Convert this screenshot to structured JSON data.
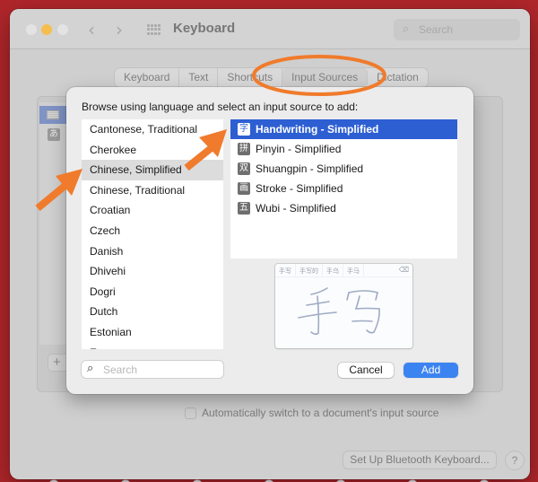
{
  "window": {
    "title": "Keyboard",
    "search_placeholder": "Search",
    "tabs": [
      {
        "label": "Keyboard",
        "active": false
      },
      {
        "label": "Text",
        "active": false
      },
      {
        "label": "Shortcuts",
        "active": false
      },
      {
        "label": "Input Sources",
        "active": true
      },
      {
        "label": "Dictation",
        "active": false
      }
    ],
    "input_sources_sidebar": [
      {
        "icon": "us-flag-icon",
        "selected": true
      },
      {
        "icon": "japanese-kana-icon",
        "glyph": "あ",
        "selected": false
      }
    ],
    "add_button": "+",
    "auto_switch_label": "Automatically switch to a document's input source",
    "auto_switch_checked": false,
    "bluetooth_button": "Set Up Bluetooth Keyboard...",
    "help_button": "?"
  },
  "sheet": {
    "title": "Browse using language and select an input source to add:",
    "languages": [
      {
        "label": "Cantonese, Traditional",
        "selected": false
      },
      {
        "label": "Cherokee",
        "selected": false
      },
      {
        "label": "Chinese, Simplified",
        "selected": true
      },
      {
        "label": "Chinese, Traditional",
        "selected": false
      },
      {
        "label": "Croatian",
        "selected": false
      },
      {
        "label": "Czech",
        "selected": false
      },
      {
        "label": "Danish",
        "selected": false
      },
      {
        "label": "Dhivehi",
        "selected": false
      },
      {
        "label": "Dogri",
        "selected": false
      },
      {
        "label": "Dutch",
        "selected": false
      },
      {
        "label": "Estonian",
        "selected": false
      },
      {
        "label": "E…",
        "selected": false
      }
    ],
    "input_methods": [
      {
        "label": "Handwriting - Simplified",
        "glyph": "字",
        "selected": true
      },
      {
        "label": "Pinyin - Simplified",
        "glyph": "拼",
        "selected": false
      },
      {
        "label": "Shuangpin - Simplified",
        "glyph": "双",
        "selected": false
      },
      {
        "label": "Stroke - Simplified",
        "glyph": "画",
        "selected": false
      },
      {
        "label": "Wubi - Simplified",
        "glyph": "五",
        "selected": false
      }
    ],
    "preview": {
      "candidates": [
        "手写",
        "手写的",
        "手乌",
        "手马"
      ],
      "delete_glyph": "⌫",
      "handwritten_text": "手写"
    },
    "search_placeholder": "Search",
    "cancel_button": "Cancel",
    "add_button": "Add"
  },
  "annotations": {
    "color": "#f07b2c",
    "highlight": "Input Sources tab circled",
    "arrows": [
      "pointing to Chinese, Simplified",
      "pointing to Handwriting - Simplified"
    ]
  }
}
